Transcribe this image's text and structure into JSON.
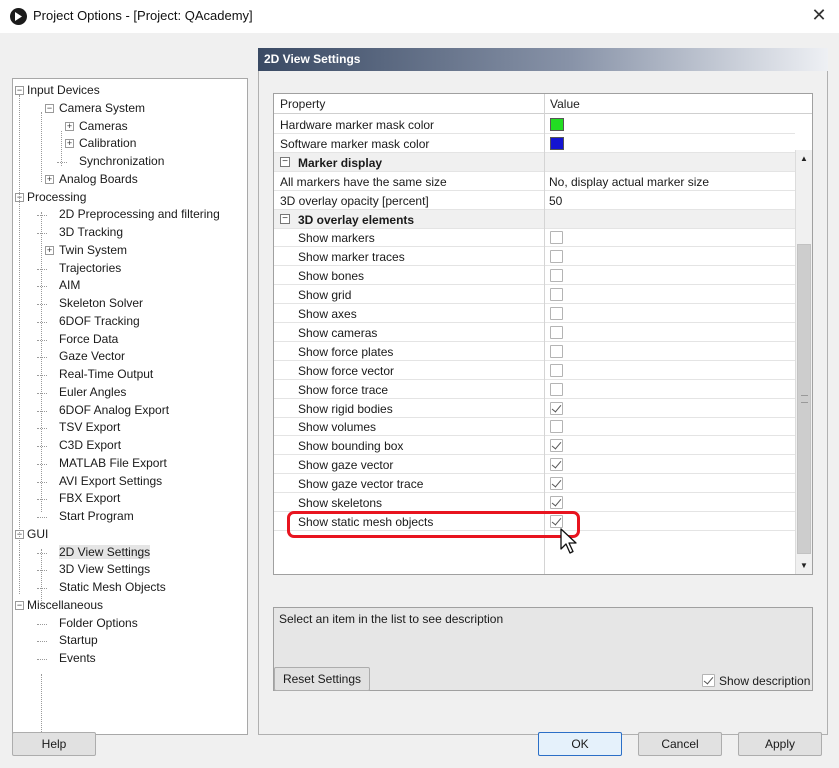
{
  "window": {
    "title": "Project Options - [Project: QAcademy]",
    "close_glyph": "✕"
  },
  "tree": {
    "items": [
      {
        "label": "Input Devices"
      },
      {
        "label": "Camera System"
      },
      {
        "label": "Cameras"
      },
      {
        "label": "Calibration"
      },
      {
        "label": "Synchronization"
      },
      {
        "label": "Analog Boards"
      },
      {
        "label": "Processing"
      },
      {
        "label": "2D Preprocessing and filtering"
      },
      {
        "label": "3D Tracking"
      },
      {
        "label": "Twin System"
      },
      {
        "label": "Trajectories"
      },
      {
        "label": "AIM"
      },
      {
        "label": "Skeleton Solver"
      },
      {
        "label": "6DOF Tracking"
      },
      {
        "label": "Force Data"
      },
      {
        "label": "Gaze Vector"
      },
      {
        "label": "Real-Time Output"
      },
      {
        "label": "Euler Angles"
      },
      {
        "label": "6DOF Analog Export"
      },
      {
        "label": "TSV Export"
      },
      {
        "label": "C3D Export"
      },
      {
        "label": "MATLAB File Export"
      },
      {
        "label": "AVI Export Settings"
      },
      {
        "label": "FBX Export"
      },
      {
        "label": "Start Program"
      },
      {
        "label": "GUI"
      },
      {
        "label": "2D View Settings"
      },
      {
        "label": "3D View Settings"
      },
      {
        "label": "Static Mesh Objects"
      },
      {
        "label": "Miscellaneous"
      },
      {
        "label": "Folder Options"
      },
      {
        "label": "Startup"
      },
      {
        "label": "Events"
      }
    ],
    "selected": "2D View Settings"
  },
  "panel": {
    "header": "2D View Settings"
  },
  "grid": {
    "col_property": "Property",
    "col_value": "Value",
    "rows": [
      {
        "label": "Hardware marker mask color",
        "color": "#22dd22"
      },
      {
        "label": "Software marker mask color",
        "color": "#1414d2"
      },
      {
        "label": "Marker display",
        "toggle": "−"
      },
      {
        "label": "All markers have the same size",
        "value": "No, display actual marker size"
      },
      {
        "label": "3D overlay opacity [percent]",
        "value": "50"
      },
      {
        "label": "3D overlay elements",
        "toggle": "−"
      },
      {
        "label": "Show markers",
        "checked": false
      },
      {
        "label": "Show marker traces",
        "checked": false
      },
      {
        "label": "Show bones",
        "checked": false
      },
      {
        "label": "Show grid",
        "checked": false
      },
      {
        "label": "Show axes",
        "checked": false
      },
      {
        "label": "Show cameras",
        "checked": false
      },
      {
        "label": "Show force plates",
        "checked": false
      },
      {
        "label": "Show force vector",
        "checked": false
      },
      {
        "label": "Show force trace",
        "checked": false
      },
      {
        "label": "Show rigid bodies",
        "checked": true
      },
      {
        "label": "Show volumes",
        "checked": false
      },
      {
        "label": "Show bounding box",
        "checked": true
      },
      {
        "label": "Show gaze vector",
        "checked": true
      },
      {
        "label": "Show gaze vector trace",
        "checked": true
      },
      {
        "label": "Show skeletons",
        "checked": true
      },
      {
        "label": "Show static mesh objects",
        "checked": true
      }
    ]
  },
  "description": {
    "text": "Select an item in the list to see description"
  },
  "buttons": {
    "reset": "Reset Settings",
    "help": "Help",
    "ok": "OK",
    "cancel": "Cancel",
    "apply": "Apply"
  },
  "show_description": {
    "label": "Show description",
    "checked": true
  },
  "colors": {
    "highlight": "#e8141f",
    "hardware_mask": "#22dd22",
    "software_mask": "#1414d2"
  }
}
